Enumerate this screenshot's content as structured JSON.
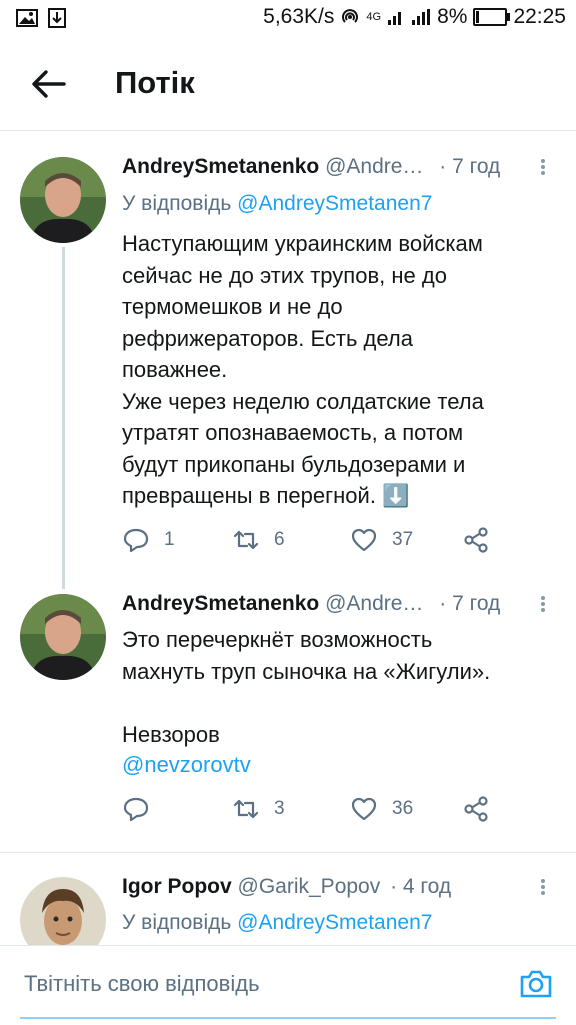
{
  "status_bar": {
    "speed": "5,63K/s",
    "network": "4G",
    "battery": "8%",
    "time": "22:25"
  },
  "header": {
    "title": "Потік"
  },
  "tweets": [
    {
      "name": "AndreySmetanenko",
      "handle": "@Andre…",
      "time": "· 7 год",
      "reply_prefix": "У відповідь",
      "reply_handle": "@AndreySmetanen7",
      "text": "Наступающим украинским войскам\nсейчас не до этих трупов, не до\nтермомешков и не до\nрефрижераторов. Есть дела\nповажнее.\nУже через неделю  солдатские тела\nутратят  опознаваемость, а потом\nбудут прикопаны бульдозерами и\nпревращены в перегной. ⬇️",
      "replies": "1",
      "retweets": "6",
      "likes": "37"
    },
    {
      "name": "AndreySmetanenko",
      "handle": "@Andre…",
      "time": "· 7 год",
      "text": "Это перечеркнёт возможность\nмахнуть труп сыночка на «Жигули».\n\nНевзоров",
      "mention": "@nevzorovtv",
      "replies": "",
      "retweets": "3",
      "likes": "36"
    },
    {
      "name": "Igor Popov",
      "handle": "@Garik_Popov",
      "time": "· 4 год",
      "reply_prefix": "У відповідь",
      "reply_handle": "@AndreySmetanen7"
    }
  ],
  "composer": {
    "placeholder": "Твітніть свою відповідь"
  },
  "colors": {
    "accent": "#1da1f2",
    "secondary_text": "#5b7083",
    "divider": "#e1e8ed"
  },
  "icons": [
    "gallery-icon",
    "download-icon",
    "hotspot-icon",
    "signal-icon",
    "battery-icon",
    "back-arrow-icon",
    "more-icon",
    "reply-icon",
    "retweet-icon",
    "like-icon",
    "share-icon",
    "camera-icon"
  ]
}
